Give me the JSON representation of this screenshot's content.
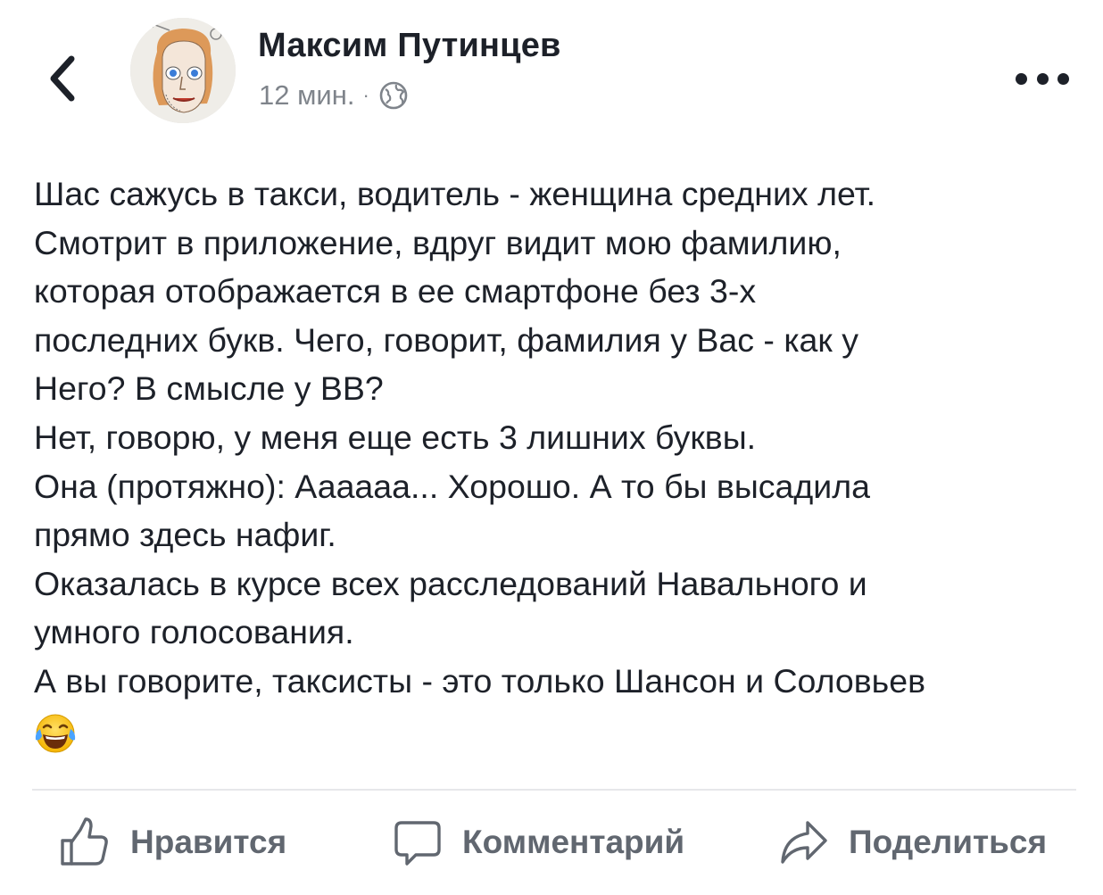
{
  "post": {
    "author": "Максим Путинцев",
    "time": "12 мин.",
    "separator": "·",
    "privacy_icon": "globe-icon",
    "text": "Шас сажусь в такси, водитель - женщина средних лет.\nСмотрит в приложение, вдруг видит мою фамилию,\nкоторая отображается в ее смартфоне без 3-х\nпоследних букв. Чего, говорит, фамилия у Вас - как у\nНего? В смысле у ВВ?\nНет, говорю, у меня еще есть 3 лишних буквы.\nОна (протяжно): Аааааа... Хорошо. А то бы высадила\nпрямо здесь нафиг.\nОказалась в курсе всех расследований Навального и\nумного голосования.\nА вы говорите, таксисты - это только Шансон и Соловьев",
    "emoji": "face-with-tears-of-joy"
  },
  "nav": {
    "back_icon": "chevron-left-icon",
    "more_icon": "more-dots-icon"
  },
  "actions": {
    "like": "Нравится",
    "comment": "Комментарий",
    "share": "Поделиться"
  },
  "colors": {
    "text": "#1d2129",
    "secondary": "#7f848b",
    "action": "#616770",
    "divider": "#e6e7ea"
  }
}
